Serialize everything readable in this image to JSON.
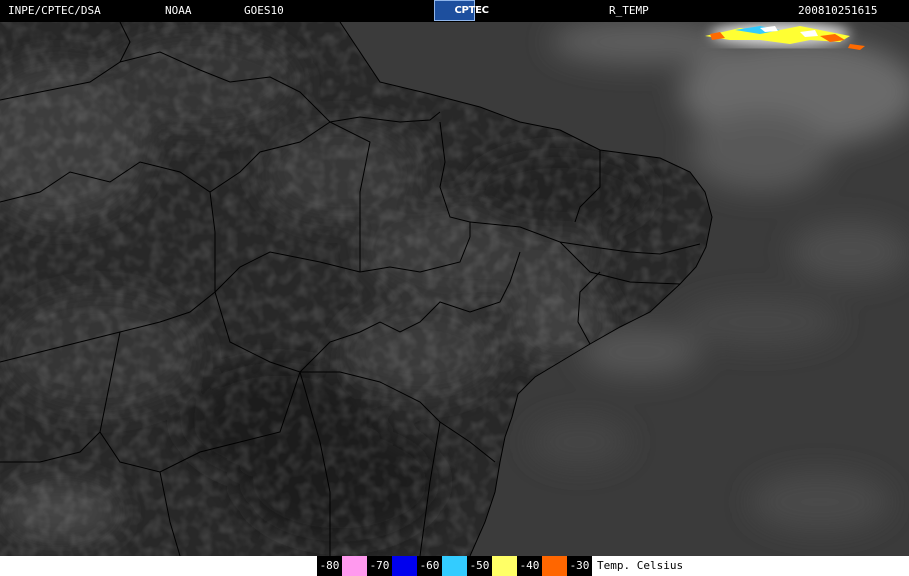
{
  "header": {
    "organization": "INPE/CPTEC/DSA",
    "agency": "NOAA",
    "satellite": "GOES10",
    "product": "R_TEMP",
    "timestamp": "200810251615",
    "logo_text": "CPTEC"
  },
  "colors": {
    "header_bg": "#000000",
    "ocean": "#3a3a3a",
    "land": "#262626",
    "boundaries": "#000000",
    "cold_cloud_yellow": "#ffff33",
    "cold_cloud_orange": "#ff6a00",
    "cold_cloud_cyan": "#33ccff"
  },
  "legend": {
    "items": [
      {
        "label": "-80",
        "color": "#ff99ee"
      },
      {
        "label": "-70",
        "color": "#0000ee"
      },
      {
        "label": "-60",
        "color": "#33ccff"
      },
      {
        "label": "-50",
        "color": "#ffff66"
      },
      {
        "label": "-40",
        "color": "#ff6600"
      },
      {
        "label": "-30",
        "color": null
      }
    ],
    "unit_label": "Temp. Celsius"
  }
}
